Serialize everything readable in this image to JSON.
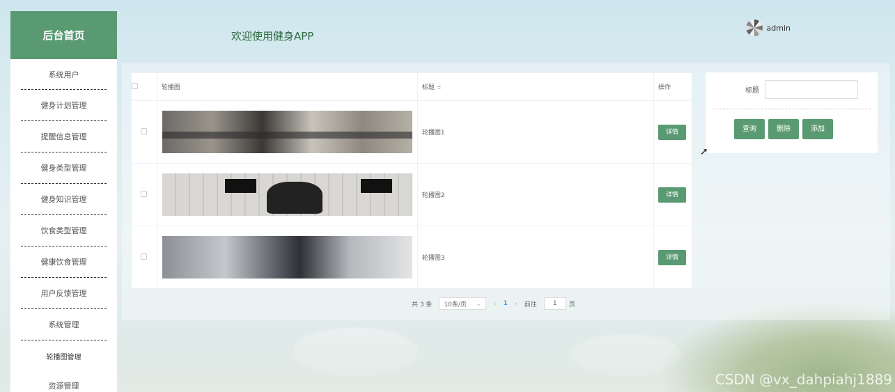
{
  "sidebar": {
    "title": "后台首页",
    "items": [
      {
        "label": "系统用户"
      },
      {
        "label": "健身计划管理"
      },
      {
        "label": "提醒信息管理"
      },
      {
        "label": "健身类型管理"
      },
      {
        "label": "健身知识管理"
      },
      {
        "label": "饮食类型管理"
      },
      {
        "label": "健康饮食管理"
      },
      {
        "label": "用户反馈管理"
      },
      {
        "label": "系统管理"
      },
      {
        "label": "轮播图管理"
      },
      {
        "label": "资源管理"
      }
    ]
  },
  "header": {
    "welcome": "欢迎使用健身APP",
    "user": "admin"
  },
  "table": {
    "columns": {
      "image": "轮播图",
      "title": "标题",
      "sort_icon": "≑",
      "operation": "操作"
    },
    "rows": [
      {
        "title": "轮播图1",
        "action": "详情"
      },
      {
        "title": "轮播图2",
        "action": "详情"
      },
      {
        "title": "轮播图3",
        "action": "详情"
      }
    ]
  },
  "pagination": {
    "total": "共 3 条",
    "page_size": "10条/页",
    "prev": "‹",
    "current": "1",
    "next": "›",
    "goto_prefix": "前往",
    "goto_value": "1",
    "goto_suffix": "页"
  },
  "search": {
    "label": "标题",
    "value": "",
    "buttons": {
      "query": "查询",
      "delete": "删除",
      "add": "添加"
    }
  },
  "watermark": "CSDN @vx_dahpiahj1889",
  "colors": {
    "accent": "#5a9a73",
    "link": "#409eff"
  }
}
